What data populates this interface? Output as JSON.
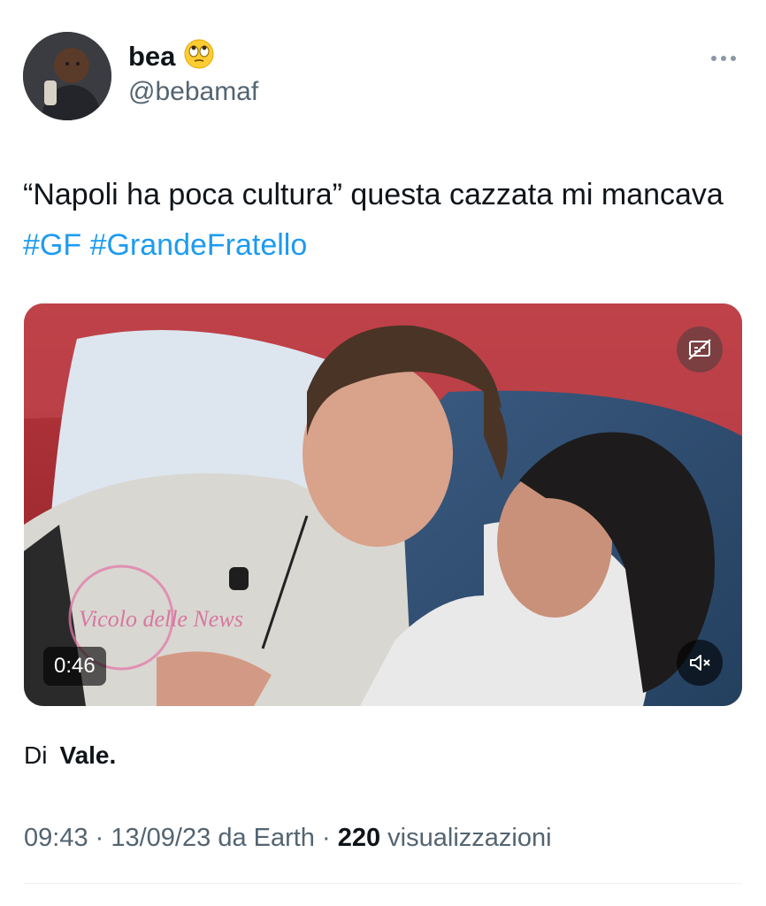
{
  "author": {
    "display_name": "bea",
    "emoji": "🙄",
    "handle": "@bebamaf"
  },
  "tweet": {
    "text_parts": [
      "“Napoli ha poca cultura” questa cazzata mi mancava ",
      "#GF",
      " ",
      "#GrandeFratello"
    ]
  },
  "media": {
    "duration": "0:46",
    "watermark_text": "Vicolo delle News",
    "icons": {
      "captions": "closed-captions-off-icon",
      "mute": "volume-muted-icon",
      "more": "more-options-icon"
    }
  },
  "credit": {
    "prefix": "Di",
    "author": "Vale."
  },
  "meta": {
    "time": "09:43",
    "separator": " · ",
    "date": "13/09/23",
    "source": "da Earth",
    "views_count": "220",
    "views_label": " visualizzazioni"
  },
  "colors": {
    "hashtag": "#1d9bf0",
    "secondary_text": "#536471",
    "primary_text": "#0f1419"
  }
}
